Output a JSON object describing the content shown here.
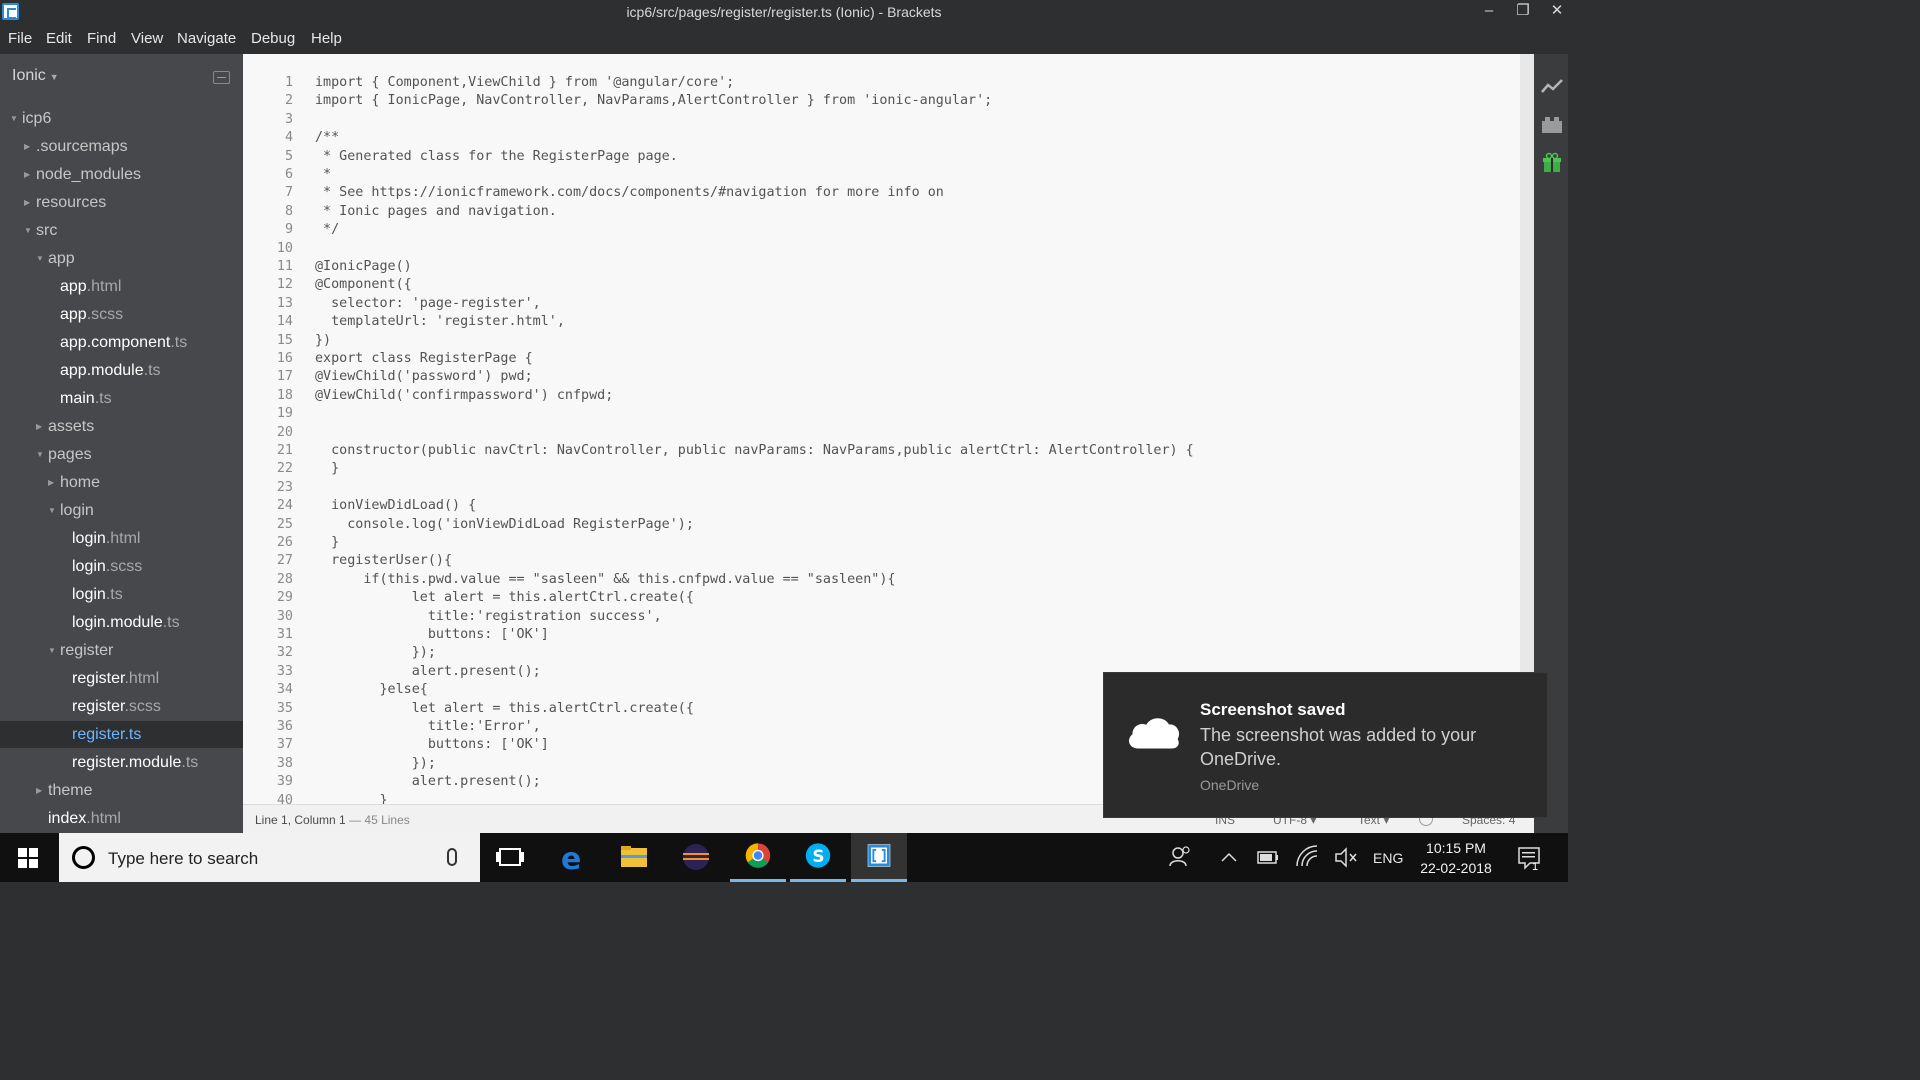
{
  "window": {
    "title": "icp6/src/pages/register/register.ts (Ionic) - Brackets",
    "minimize": "–",
    "restore": "❐",
    "close": "✕"
  },
  "menu": [
    "File",
    "Edit",
    "Find",
    "View",
    "Navigate",
    "Debug",
    "Help"
  ],
  "sidebar": {
    "project": "Ionic",
    "tree": [
      {
        "name": "icp6",
        "ext": "",
        "type": "folder",
        "open": true,
        "depth": 0
      },
      {
        "name": ".sourcemaps",
        "ext": "",
        "type": "folder",
        "open": false,
        "depth": 1
      },
      {
        "name": "node_modules",
        "ext": "",
        "type": "folder",
        "open": false,
        "depth": 1
      },
      {
        "name": "resources",
        "ext": "",
        "type": "folder",
        "open": false,
        "depth": 1
      },
      {
        "name": "src",
        "ext": "",
        "type": "folder",
        "open": true,
        "depth": 1
      },
      {
        "name": "app",
        "ext": "",
        "type": "folder",
        "open": true,
        "depth": 2
      },
      {
        "name": "app",
        "ext": ".html",
        "type": "file",
        "depth": 3
      },
      {
        "name": "app",
        "ext": ".scss",
        "type": "file",
        "depth": 3
      },
      {
        "name": "app.component",
        "ext": ".ts",
        "type": "file",
        "depth": 3
      },
      {
        "name": "app.module",
        "ext": ".ts",
        "type": "file",
        "depth": 3
      },
      {
        "name": "main",
        "ext": ".ts",
        "type": "file",
        "depth": 3
      },
      {
        "name": "assets",
        "ext": "",
        "type": "folder",
        "open": false,
        "depth": 2
      },
      {
        "name": "pages",
        "ext": "",
        "type": "folder",
        "open": true,
        "depth": 2
      },
      {
        "name": "home",
        "ext": "",
        "type": "folder",
        "open": false,
        "depth": 3
      },
      {
        "name": "login",
        "ext": "",
        "type": "folder",
        "open": true,
        "depth": 3
      },
      {
        "name": "login",
        "ext": ".html",
        "type": "file",
        "depth": 4
      },
      {
        "name": "login",
        "ext": ".scss",
        "type": "file",
        "depth": 4
      },
      {
        "name": "login",
        "ext": ".ts",
        "type": "file",
        "depth": 4
      },
      {
        "name": "login.module",
        "ext": ".ts",
        "type": "file",
        "depth": 4
      },
      {
        "name": "register",
        "ext": "",
        "type": "folder",
        "open": true,
        "depth": 3
      },
      {
        "name": "register",
        "ext": ".html",
        "type": "file",
        "depth": 4
      },
      {
        "name": "register",
        "ext": ".scss",
        "type": "file",
        "depth": 4
      },
      {
        "name": "register",
        "ext": ".ts",
        "type": "file",
        "depth": 4,
        "selected": true
      },
      {
        "name": "register.module",
        "ext": ".ts",
        "type": "file",
        "depth": 4
      },
      {
        "name": "theme",
        "ext": "",
        "type": "folder",
        "open": false,
        "depth": 2
      },
      {
        "name": "index",
        "ext": ".html",
        "type": "file",
        "depth": 2
      }
    ]
  },
  "editor": {
    "lines": [
      "import { Component,ViewChild } from '@angular/core';",
      "import { IonicPage, NavController, NavParams,AlertController } from 'ionic-angular';",
      "",
      "/**",
      " * Generated class for the RegisterPage page.",
      " *",
      " * See https://ionicframework.com/docs/components/#navigation for more info on",
      " * Ionic pages and navigation.",
      " */",
      "",
      "@IonicPage()",
      "@Component({",
      "  selector: 'page-register',",
      "  templateUrl: 'register.html',",
      "})",
      "export class RegisterPage {",
      "@ViewChild('password') pwd;",
      "@ViewChild('confirmpassword') cnfpwd;",
      "",
      "",
      "  constructor(public navCtrl: NavController, public navParams: NavParams,public alertCtrl: AlertController) {",
      "  }",
      "",
      "  ionViewDidLoad() {",
      "    console.log('ionViewDidLoad RegisterPage');",
      "  }",
      "  registerUser(){",
      "      if(this.pwd.value == \"sasleen\" && this.cnfpwd.value == \"sasleen\"){",
      "            let alert = this.alertCtrl.create({",
      "              title:'registration success',",
      "              buttons: ['OK']",
      "            });",
      "            alert.present();",
      "        }else{",
      "            let alert = this.alertCtrl.create({",
      "              title:'Error',",
      "              buttons: ['OK']",
      "            });",
      "            alert.present();",
      "        }"
    ]
  },
  "statusbar": {
    "cursor": "Line 1, Column 1",
    "lines": " — 45 Lines",
    "ins": "INS",
    "encoding": "UTF-8 ▾",
    "mode": "Text ▾",
    "spaces": "Spaces: 4"
  },
  "toast": {
    "title": "Screenshot saved",
    "body": "The screenshot was added to your OneDrive.",
    "source": "OneDrive"
  },
  "taskbar": {
    "search_placeholder": "Type here to search",
    "language": "ENG",
    "time": "10:15 PM",
    "date": "22-02-2018",
    "notifications": "1"
  },
  "colors": {
    "accent": "#2a8bd8",
    "selected_file": "#6bb7ff",
    "sidebar_bg": "#47484b",
    "editor_bg": "#f8f8f8"
  }
}
